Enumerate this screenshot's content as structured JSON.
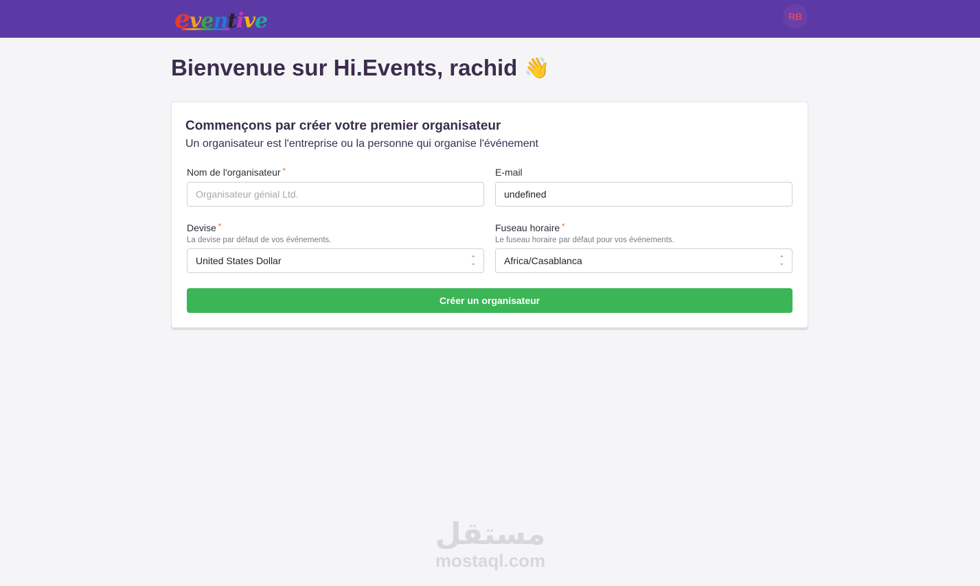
{
  "header": {
    "logo_text": "eventive",
    "avatar_initials": "RB"
  },
  "welcome": {
    "title": "Bienvenue sur Hi.Events, rachid",
    "emoji": "👋"
  },
  "card": {
    "title": "Commençons par créer votre premier organisateur",
    "subtitle": "Un organisateur est l'entreprise ou la personne qui organise l'événement"
  },
  "form": {
    "org_name": {
      "label": "Nom de l'organisateur",
      "required_mark": "*",
      "placeholder": "Organisateur génial Ltd.",
      "value": ""
    },
    "email": {
      "label": "E-mail",
      "value": "undefined"
    },
    "currency": {
      "label": "Devise",
      "required_mark": "*",
      "description": "La devise par défaut de vos événements.",
      "selected": "United States Dollar"
    },
    "timezone": {
      "label": "Fuseau horaire",
      "required_mark": "*",
      "description": "Le fuseau horaire par défaut pour vos événements.",
      "selected": "Africa/Casablanca"
    },
    "submit_label": "Créer un organisateur"
  },
  "watermark": {
    "arabic": "مستقل",
    "latin": "mostaql.com"
  },
  "colors": {
    "topbar": "#5b3aa6",
    "primary_button": "#3cb556",
    "required": "#e8590c"
  }
}
